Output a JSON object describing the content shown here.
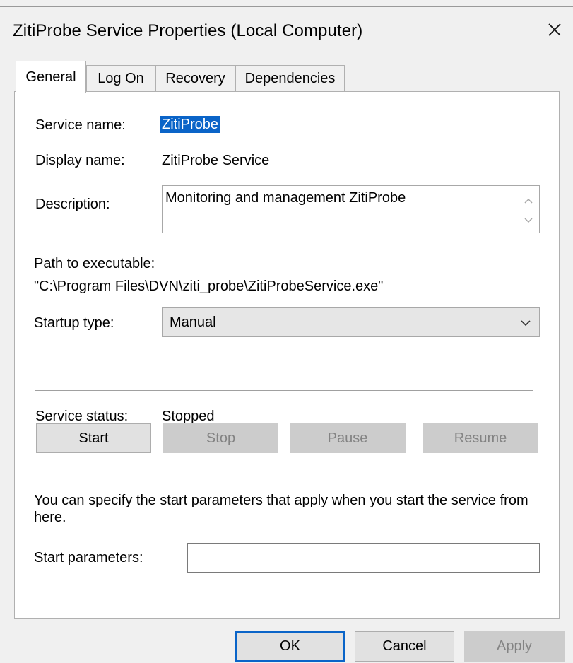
{
  "window": {
    "title": "ZitiProbe Service Properties (Local Computer)",
    "close_icon": "close-icon"
  },
  "tabs": [
    {
      "label": "General",
      "active": true
    },
    {
      "label": "Log On",
      "active": false
    },
    {
      "label": "Recovery",
      "active": false
    },
    {
      "label": "Dependencies",
      "active": false
    }
  ],
  "general": {
    "service_name_label": "Service name:",
    "service_name_value": "ZitiProbe",
    "display_name_label": "Display name:",
    "display_name_value": "ZitiProbe Service",
    "description_label": "Description:",
    "description_value": "Monitoring and management ZitiProbe",
    "path_label": "Path to executable:",
    "path_value": "\"C:\\Program Files\\DVN\\ziti_probe\\ZitiProbeService.exe\"",
    "startup_type_label": "Startup type:",
    "startup_type_value": "Manual",
    "service_status_label": "Service status:",
    "service_status_value": "Stopped",
    "buttons": {
      "start": "Start",
      "stop": "Stop",
      "pause": "Pause",
      "resume": "Resume"
    },
    "info_text": "You can specify the start parameters that apply when you start the service from here.",
    "start_parameters_label": "Start parameters:",
    "start_parameters_value": ""
  },
  "footer": {
    "ok": "OK",
    "cancel": "Cancel",
    "apply": "Apply"
  },
  "colors": {
    "selection": "#0a64c8",
    "dialog_bg": "#f0f0f0",
    "panel_bg": "#ffffff",
    "disabled_button": "#cccccc",
    "disabled_text": "#838383"
  }
}
